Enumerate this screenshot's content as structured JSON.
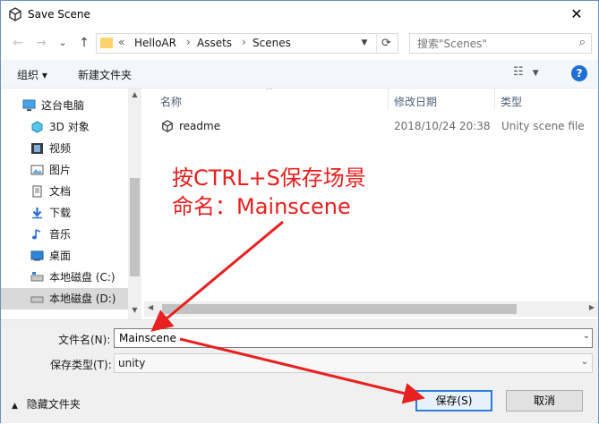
{
  "window": {
    "title": "Save Scene",
    "close_glyph": "✕"
  },
  "nav": {
    "back_glyph": "←",
    "forward_glyph": "→",
    "recent_glyph": "⌄",
    "up_glyph": "↑",
    "breadcrumb": [
      "HelloAR",
      "Assets",
      "Scenes"
    ],
    "overflow_glyph": "«",
    "search_placeholder": "搜索\"Scenes\""
  },
  "toolbar": {
    "organize_label": "组织 ▾",
    "new_folder_label": "新建文件夹"
  },
  "sidebar": {
    "items": [
      {
        "label": "这台电脑",
        "icon": "pc-icon"
      },
      {
        "label": "3D 对象",
        "icon": "3d-objects-icon"
      },
      {
        "label": "视频",
        "icon": "video-icon"
      },
      {
        "label": "图片",
        "icon": "pictures-icon"
      },
      {
        "label": "文档",
        "icon": "documents-icon"
      },
      {
        "label": "下载",
        "icon": "downloads-icon"
      },
      {
        "label": "音乐",
        "icon": "music-icon"
      },
      {
        "label": "桌面",
        "icon": "desktop-icon"
      },
      {
        "label": "本地磁盘 (C:)",
        "icon": "drive-c-icon"
      },
      {
        "label": "本地磁盘 (D:)",
        "icon": "drive-d-icon",
        "selected": true
      }
    ]
  },
  "filelist": {
    "columns": [
      "名称",
      "修改日期",
      "类型"
    ],
    "rows": [
      {
        "name": "readme",
        "modified": "2018/10/24 20:38",
        "type": "Unity scene file"
      }
    ]
  },
  "form": {
    "filename_label": "文件名(N):",
    "filename_value": "Mainscene",
    "filetype_label": "保存类型(T):",
    "filetype_value": "unity",
    "hide_folders_label": "隐藏文件夹",
    "save_label": "保存(S)",
    "cancel_label": "取消"
  },
  "annotation": {
    "line1": "按CTRL+S保存场景",
    "line2": "命名：Mainscene",
    "color": "#e8201f"
  }
}
